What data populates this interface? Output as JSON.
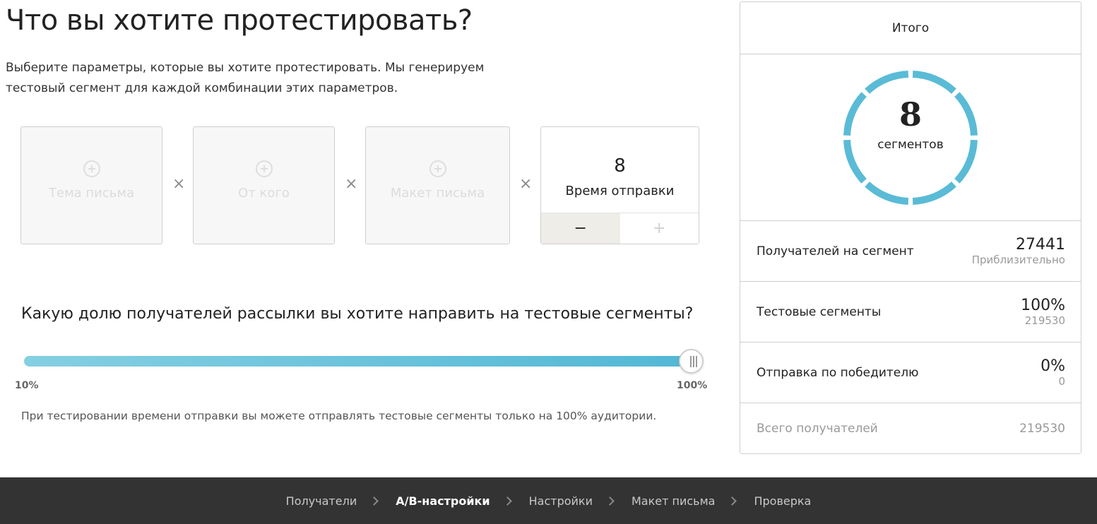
{
  "header": {
    "title": "Что вы хотите протестировать?",
    "description": "Выберите параметры, которые вы хотите протестировать. Мы генерируем тестовый сегмент для каждой комбинации этих параметров."
  },
  "params": {
    "subject_label": "Тема письма",
    "from_label": "От кого",
    "layout_label": "Макет письма",
    "times_sign": "×",
    "send_time": {
      "value": "8",
      "label": "Время отправки",
      "minus_label": "−",
      "plus_label": "+"
    }
  },
  "share": {
    "question": "Какую долю получателей рассылки вы хотите направить на тестовые сегменты?",
    "min_label": "10%",
    "max_label": "100%",
    "value_percent": 100,
    "note": "При тестировании времени отправки вы можете отправлять тестовые сегменты только на 100% аудитории."
  },
  "summary": {
    "title": "Итого",
    "segments_count": "8",
    "segments_label": "сегментов",
    "rows": [
      {
        "label": "Получателей на сегмент",
        "value": "27441",
        "sub": "Приблизительно"
      },
      {
        "label": "Тестовые сегменты",
        "value": "100%",
        "sub": "219530"
      },
      {
        "label": "Отправка по победителю",
        "value": "0%",
        "sub": "0"
      }
    ],
    "total": {
      "label": "Всего получателей",
      "value": "219530"
    }
  },
  "footer": {
    "steps": [
      {
        "label": "Получатели",
        "active": false
      },
      {
        "label": "A/B-настройки",
        "active": true
      },
      {
        "label": "Настройки",
        "active": false
      },
      {
        "label": "Макет письма",
        "active": false
      },
      {
        "label": "Проверка",
        "active": false
      }
    ]
  },
  "colors": {
    "accent": "#5abbd6",
    "footer_bg": "#333333"
  }
}
